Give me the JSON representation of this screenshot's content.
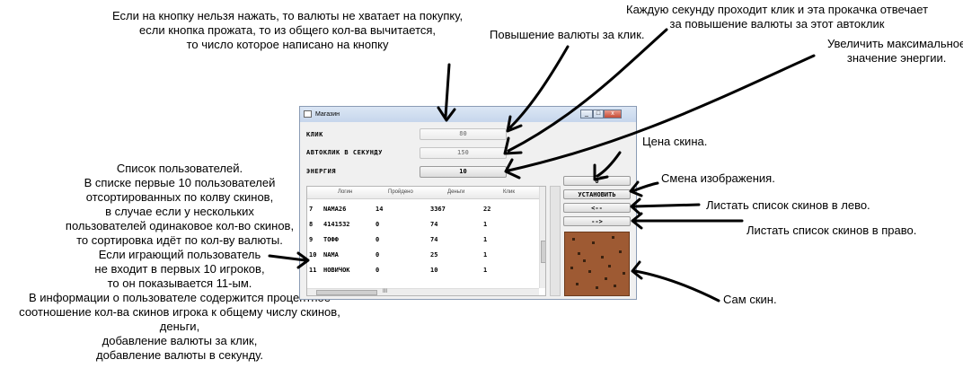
{
  "notes": {
    "top_center": [
      "Если на кнопку нельзя нажать, то валюты не хватает на покупку,",
      "если кнопка прожата, то из общего кол-ва вычитается,",
      "то число которое написано на кнопку"
    ],
    "click_increase": [
      "Повышение валюты за клик."
    ],
    "autoclick": [
      "Каждую секунду проходит клик и эта прокачка отвечает",
      "за повышение валюты за этот автоклик"
    ],
    "energy": [
      "Увеличить максимальное",
      "значение энергии."
    ],
    "skin_price": [
      "Цена скина."
    ],
    "change_image": [
      "Смена изображения."
    ],
    "scroll_left": [
      "Листать список скинов в лево."
    ],
    "scroll_right": [
      "Листать список скинов в право."
    ],
    "skin": [
      "Сам скин."
    ],
    "user_list": [
      "Список пользователей.",
      "В списке первые 10 пользователей",
      "отсортированных по колву скинов,",
      "в случае если у нескольких",
      "пользователей одинаковое кол-во скинов,",
      "то сортировка идёт по  кол-ву валюты.",
      "Если играющий пользователь",
      "не входит в первых 10 игроков,",
      "то он показывается 11-ым.",
      "В информации о пользователе содержится процентное",
      "соотношение кол-ва скинов игрока к общему числу скинов,",
      "деньги,",
      "добавление валюты за клик,",
      "добавление валюты в секунду."
    ]
  },
  "window": {
    "title": "Магазин",
    "controls": {
      "minimize": "_",
      "maximize": "□",
      "close": "x"
    }
  },
  "shop": {
    "click_label": "КЛИК",
    "click_value": "80",
    "autoclick_label": "АВТОКЛИК В СЕКУНДУ",
    "autoclick_value": "150",
    "energy_label": "ЭНЕРГИЯ",
    "energy_value": "10"
  },
  "table": {
    "columns": [
      "",
      "Логин",
      "Пройдено",
      "Деньги",
      "Клик"
    ],
    "rows": [
      [
        "7",
        "NAMA26",
        "14",
        "3367",
        "22"
      ],
      [
        "8",
        "4141532",
        "0",
        "74",
        "1"
      ],
      [
        "9",
        "ТОФФ",
        "0",
        "74",
        "1"
      ],
      [
        "10",
        "NAMA",
        "0",
        "25",
        "1"
      ],
      [
        "11",
        "НОВИЧОК",
        "0",
        "10",
        "1"
      ]
    ],
    "hscroll_marker": "III"
  },
  "skins": {
    "price": "0",
    "set_label": "УСТАНОВИТЬ",
    "left_label": "<--",
    "right_label": "-->"
  },
  "colors": {
    "skin_bg": "#9e5a33",
    "skin_spots": "#3a2210"
  }
}
